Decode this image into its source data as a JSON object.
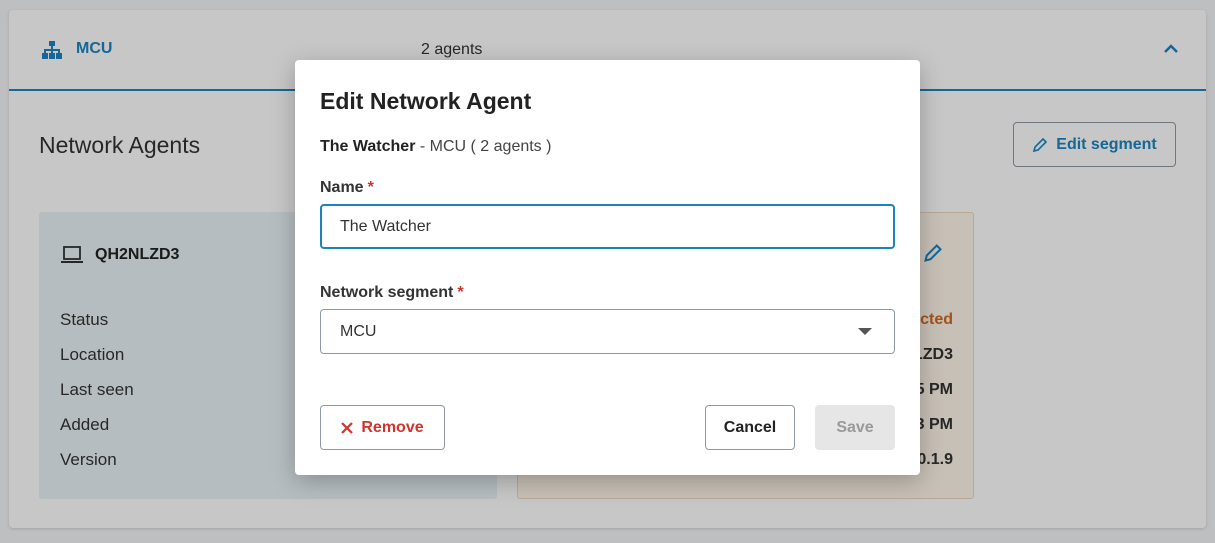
{
  "segment": {
    "name": "MCU",
    "agent_count": "2 agents",
    "section_title": "Network Agents",
    "edit_button": "Edit segment"
  },
  "agents": [
    {
      "name": "QH2NLZD3",
      "rows": [
        "Status",
        "Location",
        "Last seen",
        "Added",
        "Version"
      ]
    },
    {
      "values": [
        "cted",
        "LZD3",
        "5 PM",
        "3 PM",
        "0.1.9"
      ]
    }
  ],
  "modal": {
    "title": "Edit Network Agent",
    "subtitle_name": "The Watcher",
    "subtitle_rest": " - MCU ( 2 agents )",
    "name_label": "Name",
    "name_value": "The Watcher",
    "segment_label": "Network segment",
    "segment_value": "MCU",
    "required_mark": "*",
    "remove_label": "Remove",
    "cancel_label": "Cancel",
    "save_label": "Save"
  },
  "colors": {
    "accent": "#1a84c0",
    "danger": "#d0342c",
    "warning": "#d2691e"
  }
}
